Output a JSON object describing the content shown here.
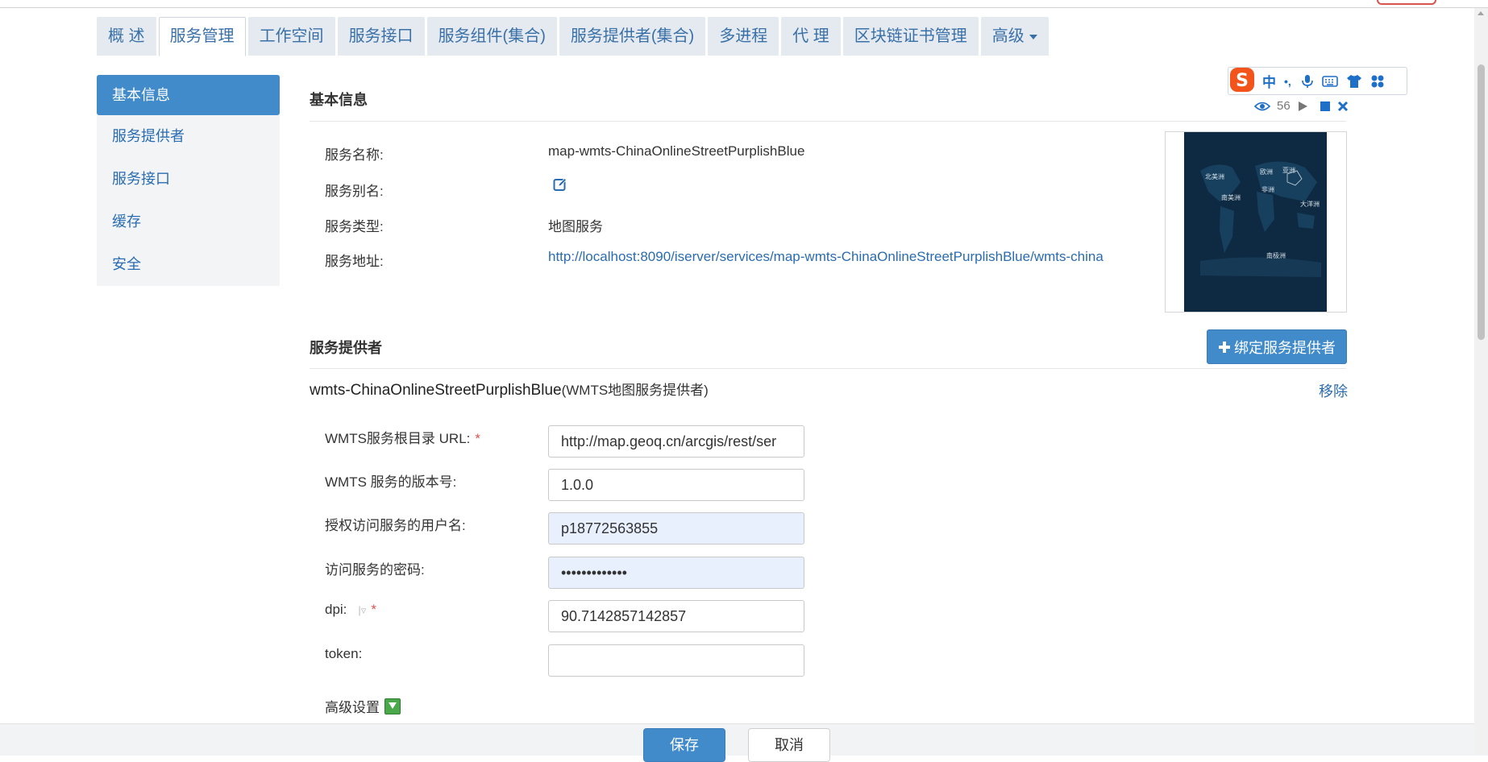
{
  "tabs": [
    {
      "label": "概 述"
    },
    {
      "label": "服务管理"
    },
    {
      "label": "工作空间"
    },
    {
      "label": "服务接口"
    },
    {
      "label": "服务组件(集合)"
    },
    {
      "label": "服务提供者(集合)"
    },
    {
      "label": "多进程"
    },
    {
      "label": "代 理"
    },
    {
      "label": "区块链证书管理"
    },
    {
      "label": "高级"
    }
  ],
  "sidebar": {
    "items": [
      {
        "label": "基本信息"
      },
      {
        "label": "服务提供者"
      },
      {
        "label": "服务接口"
      },
      {
        "label": "缓存"
      },
      {
        "label": "安全"
      }
    ]
  },
  "basic_info": {
    "title": "基本信息",
    "name_label": "服务名称:",
    "name_value": "map-wmts-ChinaOnlineStreetPurplishBlue",
    "alias_label": "服务别名:",
    "type_label": "服务类型:",
    "type_value": "地图服务",
    "address_label": "服务地址:",
    "address_value": "http://localhost:8090/iserver/services/map-wmts-ChinaOnlineStreetPurplishBlue/wmts-china"
  },
  "preview": {
    "map_labels": [
      "北美洲",
      "欧洲",
      "亚洲",
      "南美洲",
      "非洲",
      "大洋洲",
      "南极洲"
    ]
  },
  "provider": {
    "section_title": "服务提供者",
    "bind_button": "绑定服务提供者",
    "name": "wmts-ChinaOnlineStreetPurplishBlue",
    "type": "(WMTS地图服务提供者)",
    "remove_link": "移除",
    "url_label": "WMTS服务根目录 URL:",
    "url_value": "http://map.geoq.cn/arcgis/rest/ser",
    "version_label": "WMTS 服务的版本号:",
    "version_value": "1.0.0",
    "username_label": "授权访问服务的用户名:",
    "username_value": "p18772563855",
    "password_label": "访问服务的密码:",
    "password_value": "•••••••••••••",
    "dpi_label": "dpi:",
    "dpi_value": "90.7142857142857",
    "token_label": "token:",
    "token_value": "",
    "required_mark": "*",
    "advanced_label": "高级设置"
  },
  "footer": {
    "save_label": "保存",
    "cancel_label": "取消"
  },
  "ime": {
    "zh": "中",
    "punct": "•,",
    "eye_count": "56"
  },
  "colors": {
    "primary": "#428bca",
    "link": "#2a6cb0",
    "tab_bg": "#e4eaef",
    "required": "#d9534f",
    "autofill": "#e8f0fe"
  }
}
